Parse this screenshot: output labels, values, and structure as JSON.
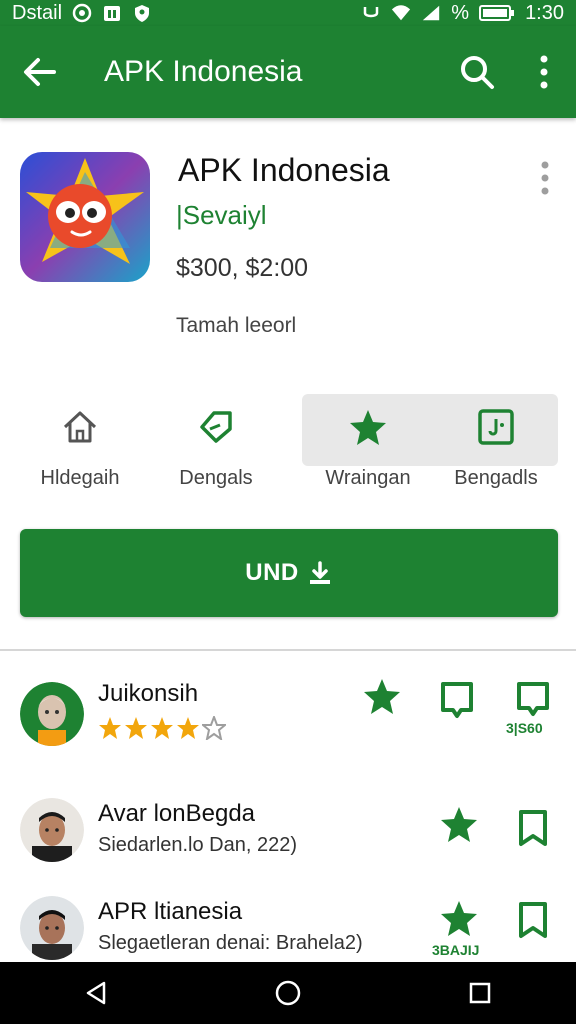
{
  "status_bar": {
    "left_text": "Dstail",
    "time": "1:30",
    "battery_percent": "%"
  },
  "app_bar": {
    "title": "APK Indonesia",
    "icons": [
      "back-arrow-icon",
      "search-icon",
      "more-vert-icon"
    ]
  },
  "app": {
    "name": "APK Indonesia",
    "developer": "|Sevaiyl",
    "price": "$300, $2:00",
    "tagline": "Tamah leeorl"
  },
  "actions": [
    {
      "label": "Hldegaih",
      "icon": "home-icon"
    },
    {
      "label": "Dengals",
      "icon": "tag-icon"
    },
    {
      "label": "Wraingan",
      "icon": "star-icon"
    },
    {
      "label": "Bengadls",
      "icon": "calendar-icon"
    }
  ],
  "install_button": {
    "label": "UND",
    "icon": "download-icon"
  },
  "reviews": [
    {
      "name": "Juikonsih",
      "rating": 4,
      "max_rating": 5,
      "count": "3|S60"
    },
    {
      "name": "Avar lonBegda",
      "subtitle": "Siedarlen.lo Dan, 222)"
    },
    {
      "name": "APR ltianesia",
      "subtitle": "Slegaetleran denai: Brahela2)",
      "count": "3BAJIJ"
    }
  ],
  "colors": {
    "primary": "#1e8232",
    "star_gold": "#f2a60c",
    "nav_bar": "#000000"
  }
}
